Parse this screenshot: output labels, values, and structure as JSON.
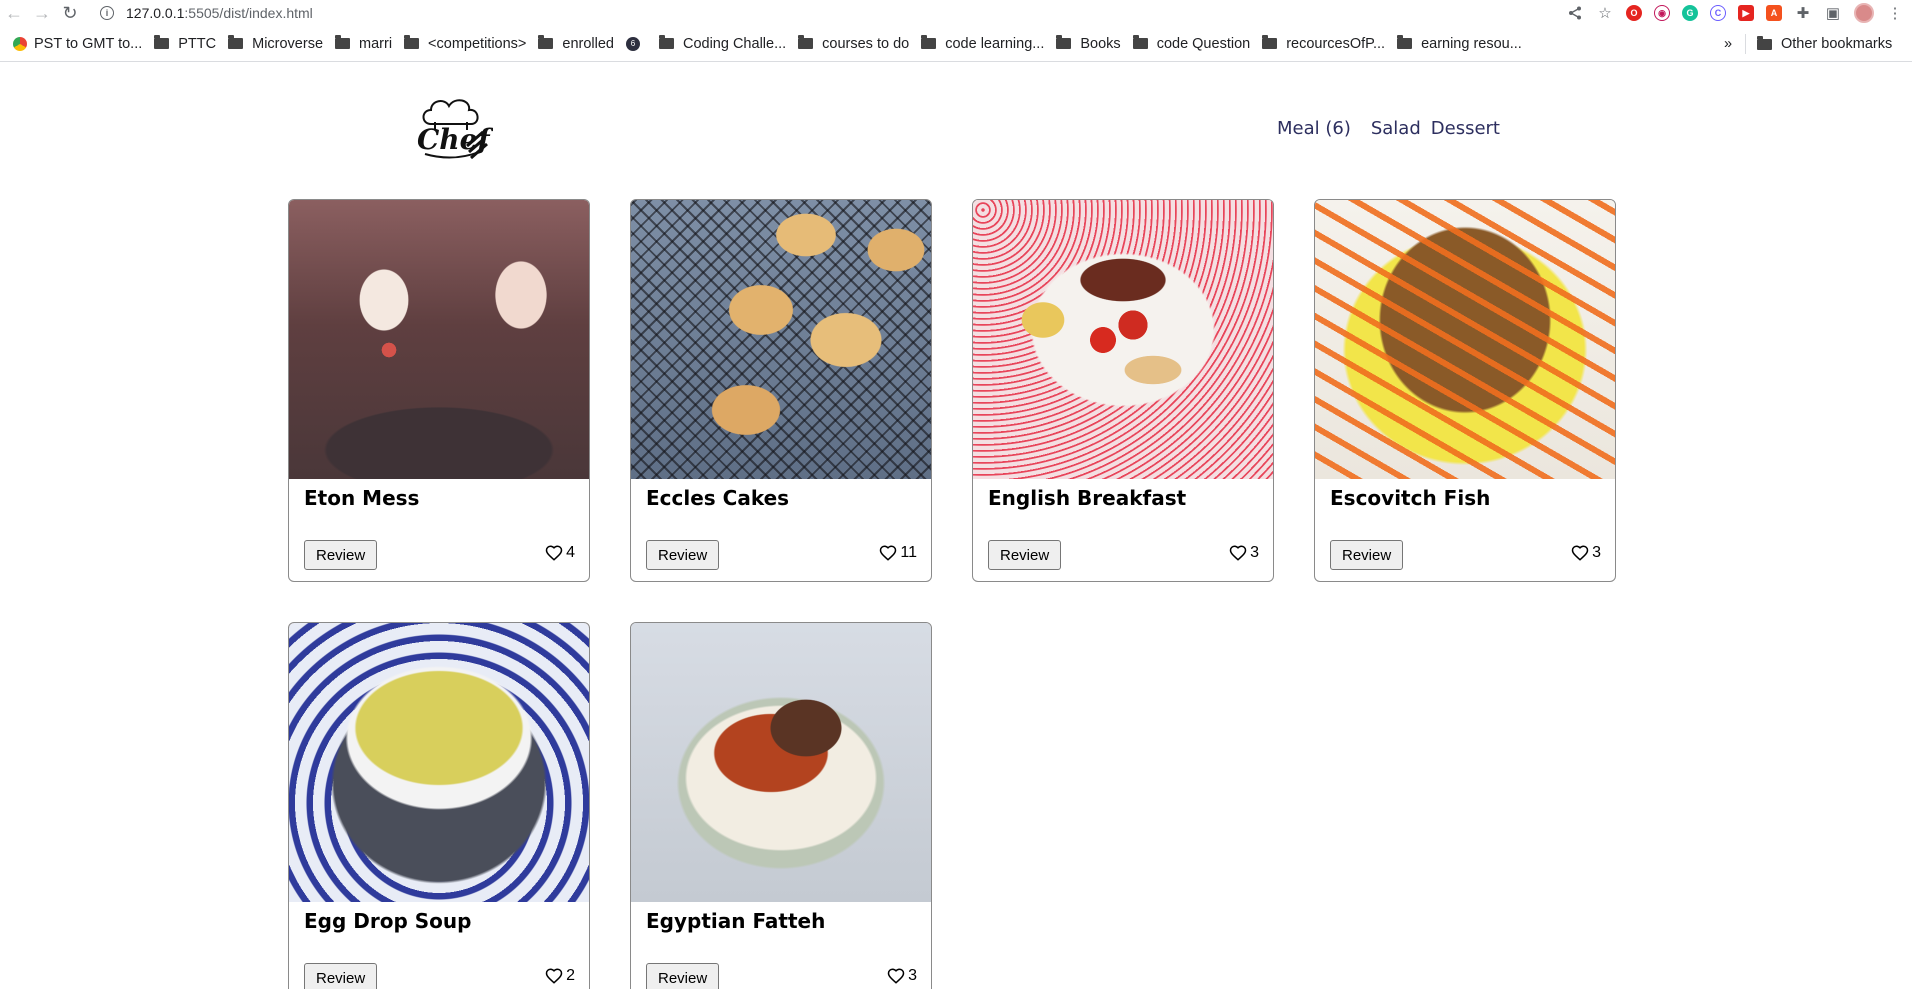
{
  "browser": {
    "url_host": "127.0.0.1",
    "url_path": ":5505/dist/index.html",
    "bookmarks": [
      {
        "label": "PST to GMT to...",
        "icon": "chrome-favicon"
      },
      {
        "label": "PTTC",
        "icon": "folder-icon"
      },
      {
        "label": "Microverse",
        "icon": "folder-icon"
      },
      {
        "label": "marri",
        "icon": "folder-icon"
      },
      {
        "label": "<competitions>",
        "icon": "folder-icon"
      },
      {
        "label": "enrolled",
        "icon": "folder-icon"
      },
      {
        "label": "",
        "icon": "site-favicon"
      },
      {
        "label": "Coding Challe...",
        "icon": "folder-icon"
      },
      {
        "label": "courses to do",
        "icon": "folder-icon"
      },
      {
        "label": "code learning...",
        "icon": "folder-icon"
      },
      {
        "label": "Books",
        "icon": "folder-icon"
      },
      {
        "label": "code Question",
        "icon": "folder-icon"
      },
      {
        "label": "recourcesOfP...",
        "icon": "folder-icon"
      },
      {
        "label": "earning resou...",
        "icon": "folder-icon"
      }
    ],
    "overflow_label": "»",
    "other_bookmarks_label": "Other bookmarks"
  },
  "header": {
    "logo_text": "Chef",
    "nav": [
      {
        "label": "Meal (6)"
      },
      {
        "label": "Salad"
      },
      {
        "label": "Dessert"
      }
    ]
  },
  "meals": [
    {
      "name": "Eton Mess",
      "likes": "4",
      "review_label": "Review"
    },
    {
      "name": "Eccles Cakes",
      "likes": "11",
      "review_label": "Review"
    },
    {
      "name": "English Breakfast",
      "likes": "3",
      "review_label": "Review"
    },
    {
      "name": "Escovitch Fish",
      "likes": "3",
      "review_label": "Review"
    },
    {
      "name": "Egg Drop Soup",
      "likes": "2",
      "review_label": "Review"
    },
    {
      "name": "Egyptian Fatteh",
      "likes": "3",
      "review_label": "Review"
    }
  ],
  "colors": {
    "nav_text": "#2d2f5f",
    "card_border": "#8a8a8a"
  }
}
